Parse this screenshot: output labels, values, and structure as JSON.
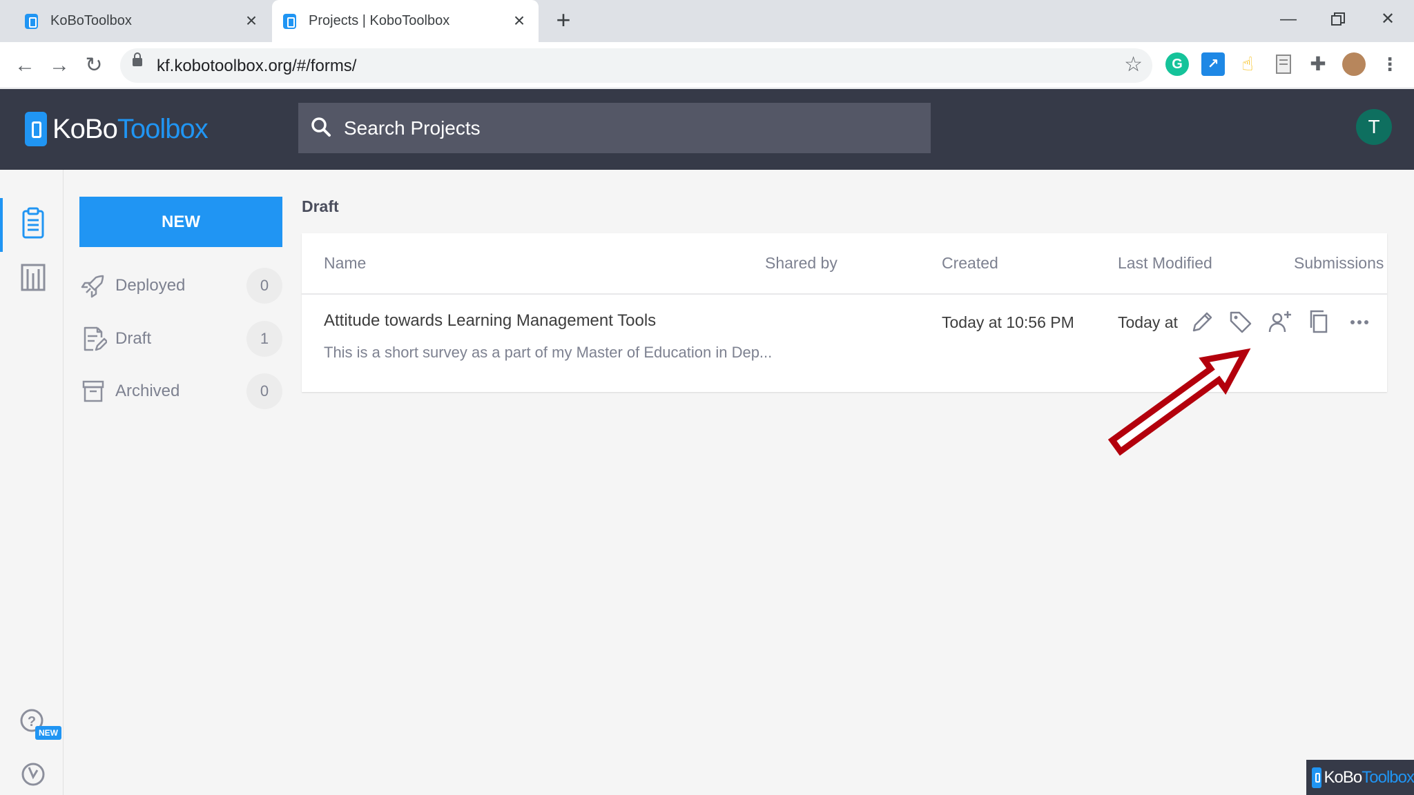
{
  "browser": {
    "tabs": [
      {
        "title": "KoBoToolbox",
        "active": false
      },
      {
        "title": "Projects | KoboToolbox",
        "active": true
      }
    ],
    "url": "kf.kobotoolbox.org/#/forms/"
  },
  "header": {
    "logo_kobo": "KoBo",
    "logo_toolbox": "Toolbox",
    "search_placeholder": "Search Projects",
    "avatar_initial": "T",
    "colors": {
      "bar": "#363a48",
      "accent": "#2095f3",
      "avatar": "#0e6f5f"
    }
  },
  "sidebar": {
    "new_label": "NEW",
    "items": [
      {
        "label": "Deployed",
        "count": "0",
        "icon": "rocket-icon"
      },
      {
        "label": "Draft",
        "count": "1",
        "icon": "draft-form-icon"
      },
      {
        "label": "Archived",
        "count": "0",
        "icon": "archive-box-icon"
      }
    ]
  },
  "rail": {
    "icons": [
      "forms-clipboard-icon",
      "library-icon",
      "help-icon",
      "support-icon"
    ],
    "help_badge": "NEW"
  },
  "main": {
    "section_title": "Draft",
    "columns": [
      "Name",
      "Shared by",
      "Created",
      "Last Modified",
      "Submissions"
    ],
    "rows": [
      {
        "name": "Attitude towards Learning Management Tools",
        "description": "This is a short survey as a part of my Master of Education in Dep...",
        "shared_by": "",
        "created": "Today at 10:56 PM",
        "modified": "Today at"
      }
    ],
    "row_actions": [
      "edit-pencil-icon",
      "tag-icon",
      "share-user-icon",
      "clone-icon",
      "more-icon"
    ]
  },
  "annotation": {
    "color": "#b3000c",
    "points_to": "share-user-icon"
  },
  "watermark": {
    "kobo": "KoBo",
    "toolbox": "Toolbox"
  }
}
